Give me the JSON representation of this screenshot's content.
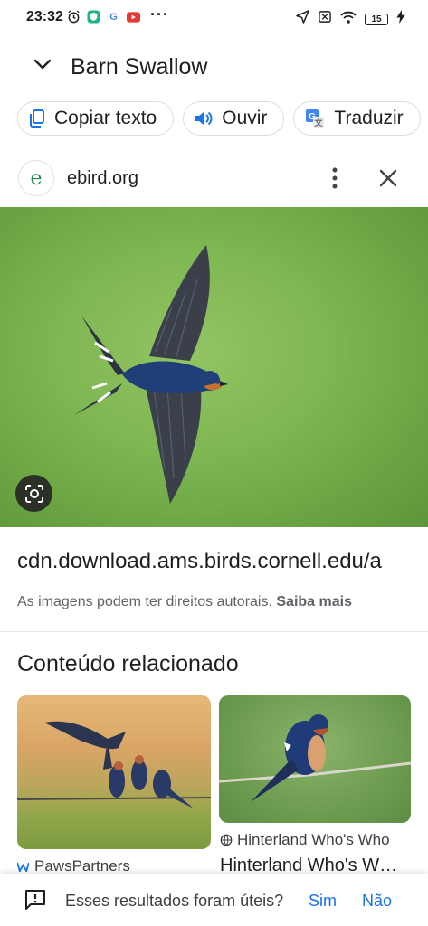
{
  "status_bar": {
    "time": "23:32",
    "battery": "15",
    "left_icons": [
      "alarm-icon",
      "shield-app-icon",
      "google-icon",
      "youtube-icon"
    ],
    "right_icons": [
      "location-arrow-icon",
      "sim-off-icon",
      "wifi-icon",
      "battery-icon",
      "charging-icon"
    ]
  },
  "header": {
    "title": "Barn Swallow"
  },
  "actions": [
    {
      "label": "Copiar texto",
      "icon": "copy-text-icon"
    },
    {
      "label": "Ouvir",
      "icon": "speaker-icon"
    },
    {
      "label": "Traduzir",
      "icon": "translate-icon"
    }
  ],
  "source": {
    "favicon_letter": "e",
    "domain": "ebird.org"
  },
  "image": {
    "subject": "barn swallow in flight",
    "lens_icon": "google-lens-icon"
  },
  "image_url": "cdn.download.ams.birds.cornell.edu/a",
  "copyright": {
    "text": "As imagens podem ter direitos autorais.",
    "link": "Saiba mais"
  },
  "related": {
    "title": "Conteúdo relacionado",
    "cards": [
      {
        "source": "PawsPartners",
        "title": ""
      },
      {
        "source": "Hinterland Who's Who",
        "title": "Hinterland Who's W…"
      }
    ]
  },
  "feedback": {
    "question": "Esses resultados foram úteis?",
    "yes": "Sim",
    "no": "Não"
  },
  "colors": {
    "link_blue": "#1a73e8",
    "text": "#1f1f1f",
    "muted": "#5f6368"
  }
}
